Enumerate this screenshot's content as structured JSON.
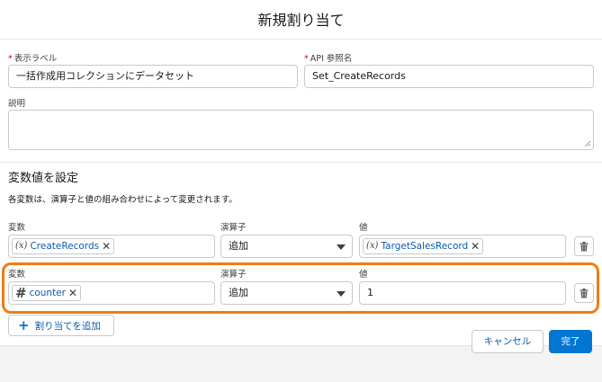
{
  "modal": {
    "title": "新規割り当て"
  },
  "form": {
    "label_field": {
      "label": "表示ラベル",
      "value": "一括作成用コレクションにデータセット"
    },
    "api_field": {
      "label": "API 参照名",
      "value": "Set_CreateRecords"
    },
    "description_field": {
      "label": "説明",
      "value": ""
    }
  },
  "section": {
    "title": "変数値を設定",
    "description": "各変数は、演算子と値の組み合わせによって変更されます。"
  },
  "rows": [
    {
      "variable_label": "変数",
      "variable_value": "CreateRecords",
      "variable_icon": "variable-icon",
      "operator_label": "演算子",
      "operator_value": "追加",
      "value_label": "値",
      "value_value": "TargetSalesRecord",
      "value_icon": "variable-icon"
    },
    {
      "variable_label": "変数",
      "variable_value": "counter",
      "variable_icon": "number-icon",
      "operator_label": "演算子",
      "operator_value": "追加",
      "value_label": "値",
      "value_value": "1"
    }
  ],
  "buttons": {
    "add_assignment": "割り当てを追加",
    "cancel": "キャンセル",
    "done": "完了"
  },
  "colors": {
    "brand": "#0176d3",
    "link": "#0b5cab",
    "highlight": "#f07c13",
    "required": "#ba0517"
  }
}
